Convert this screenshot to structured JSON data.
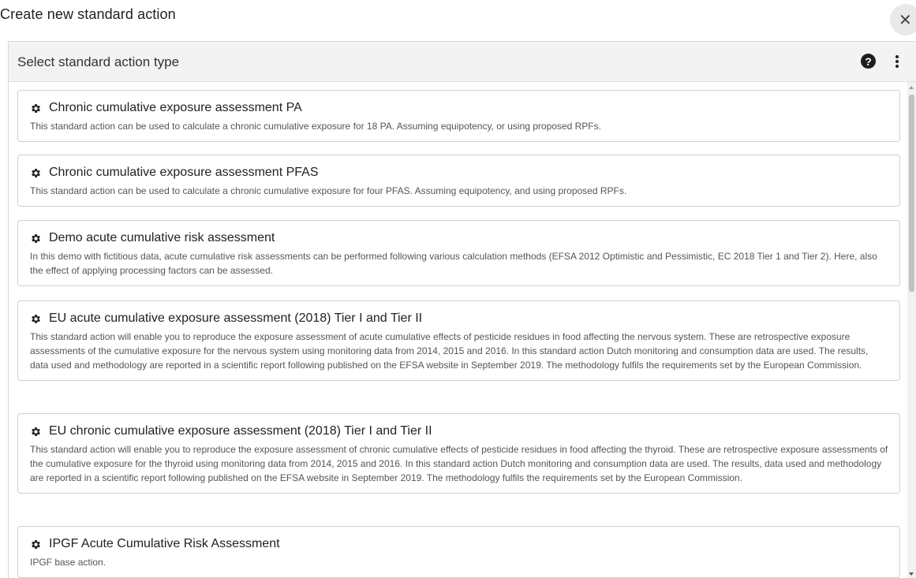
{
  "dialog": {
    "title": "Create new standard action",
    "close_label": "✕"
  },
  "panel": {
    "title": "Select standard action type",
    "help_label": "?"
  },
  "actions": [
    {
      "title": "Chronic cumulative exposure assessment PA",
      "description": "This standard action can be used to calculate a chronic cumulative exposure for 18 PA. Assuming equipotency, or using proposed RPFs."
    },
    {
      "title": "Chronic cumulative exposure assessment PFAS",
      "description": "This standard action can be used to calculate a chronic cumulative exposure for four PFAS. Assuming equipotency, and using proposed RPFs."
    },
    {
      "title": "Demo acute cumulative risk assessment",
      "description": "In this demo with fictitious data, acute cumulative risk assessments can be performed following various calculation methods (EFSA 2012 Optimistic and Pessimistic, EC 2018 Tier 1 and Tier 2). Here, also the effect of applying processing factors can be assessed."
    },
    {
      "title": "EU acute cumulative exposure assessment (2018) Tier I and Tier II",
      "description": "This standard action will enable you to reproduce the exposure assessment of acute cumulative effects of pesticide residues in food affecting the nervous system. These are retrospective exposure assessments of the cumulative exposure for the nervous system using monitoring data from 2014, 2015 and 2016. In this standard action Dutch monitoring and consumption data are used. The results, data used and methodology are reported in a scientific report following published on the EFSA website in September 2019. The methodology fulfils the requirements set by the European Commission."
    },
    {
      "title": "EU chronic cumulative exposure assessment (2018) Tier I and Tier II",
      "description": "This standard action will enable you to reproduce the exposure assessment of chronic cumulative effects of pesticide residues in food affecting the thyroid. These are retrospective exposure assessments of the cumulative exposure for the thyroid using monitoring data from 2014, 2015 and 2016. In this standard action Dutch monitoring and consumption data are used. The results, data used and methodology are reported in a scientific report following published on the EFSA website in September 2019. The methodology fulfils the requirements set by the European Commission."
    },
    {
      "title": "IPGF Acute Cumulative Risk Assessment",
      "description": "IPGF base action."
    }
  ],
  "icons": {
    "card_icon": "gear-icon",
    "close": "close-icon",
    "help": "help-icon",
    "menu": "more-vertical-icon"
  }
}
